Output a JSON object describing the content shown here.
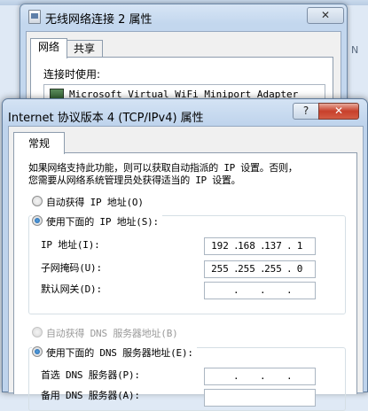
{
  "background_window": {
    "title": "无线网络连接 2 属性",
    "close_label": "✕",
    "tabs": [
      {
        "label": "网络"
      },
      {
        "label": "共享"
      }
    ],
    "connect_using_label": "连接时使用:",
    "adapter_name": "Microsoft Virtual WiFi Miniport Adapter",
    "side_text": "N"
  },
  "dialog": {
    "title": "Internet 协议版本 4 (TCP/IPv4) 属性",
    "help_label": "?",
    "close_label": "✕",
    "tab_general": "常规",
    "description_line1": "如果网络支持此功能，则可以获取自动指派的 IP 设置。否则，",
    "description_line2": "您需要从网络系统管理员处获得适当的 IP 设置。",
    "ip_section": {
      "auto_label": "自动获得 IP 地址(O)",
      "manual_label": "使用下面的 IP 地址(S):",
      "selected": "manual",
      "ip_address_label": "IP 地址(I):",
      "ip_address": [
        "192",
        "168",
        "137",
        "1"
      ],
      "subnet_mask_label": "子网掩码(U):",
      "subnet_mask": [
        "255",
        "255",
        "255",
        "0"
      ],
      "gateway_label": "默认网关(D):",
      "gateway": [
        "",
        "",
        "",
        ""
      ]
    },
    "dns_section": {
      "auto_label": "自动获得 DNS 服务器地址(B)",
      "manual_label": "使用下面的 DNS 服务器地址(E):",
      "selected": "manual",
      "preferred_label": "首选 DNS 服务器(P):",
      "preferred": [
        "",
        "",
        "",
        ""
      ],
      "alternate_label": "备用 DNS 服务器(A):"
    }
  }
}
